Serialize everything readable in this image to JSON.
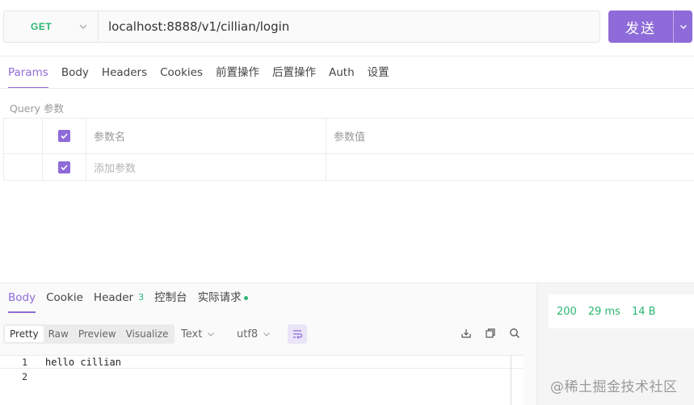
{
  "request": {
    "method": "GET",
    "url": "localhost:8888/v1/cillian/login",
    "send_label": "发送"
  },
  "request_tabs": [
    {
      "label": "Params",
      "active": true
    },
    {
      "label": "Body",
      "active": false
    },
    {
      "label": "Headers",
      "active": false
    },
    {
      "label": "Cookies",
      "active": false
    },
    {
      "label": "前置操作",
      "active": false
    },
    {
      "label": "后置操作",
      "active": false
    },
    {
      "label": "Auth",
      "active": false
    },
    {
      "label": "设置",
      "active": false
    }
  ],
  "params": {
    "section_label": "Query 参数",
    "header": {
      "name": "参数名",
      "value": "参数值"
    },
    "add_placeholder": "添加参数"
  },
  "response_tabs": [
    {
      "label": "Body",
      "active": true,
      "badge": ""
    },
    {
      "label": "Cookie",
      "active": false,
      "badge": ""
    },
    {
      "label": "Header",
      "active": false,
      "badge": "3"
    },
    {
      "label": "控制台",
      "active": false,
      "badge": ""
    },
    {
      "label": "实际请求",
      "active": false,
      "badge": ""
    }
  ],
  "view_modes": [
    {
      "label": "Pretty",
      "active": true
    },
    {
      "label": "Raw",
      "active": false
    },
    {
      "label": "Preview",
      "active": false
    },
    {
      "label": "Visualize",
      "active": false
    }
  ],
  "format_select": "Text",
  "encoding_select": "utf8",
  "status": {
    "code": "200",
    "time": "29 ms",
    "size": "14 B"
  },
  "body_lines": [
    {
      "num": "1",
      "text": "hello cillian"
    },
    {
      "num": "2",
      "text": ""
    }
  ],
  "watermark": "@稀土掘金技术社区",
  "colors": {
    "accent": "#8e6bd8",
    "success": "#2bb673"
  }
}
